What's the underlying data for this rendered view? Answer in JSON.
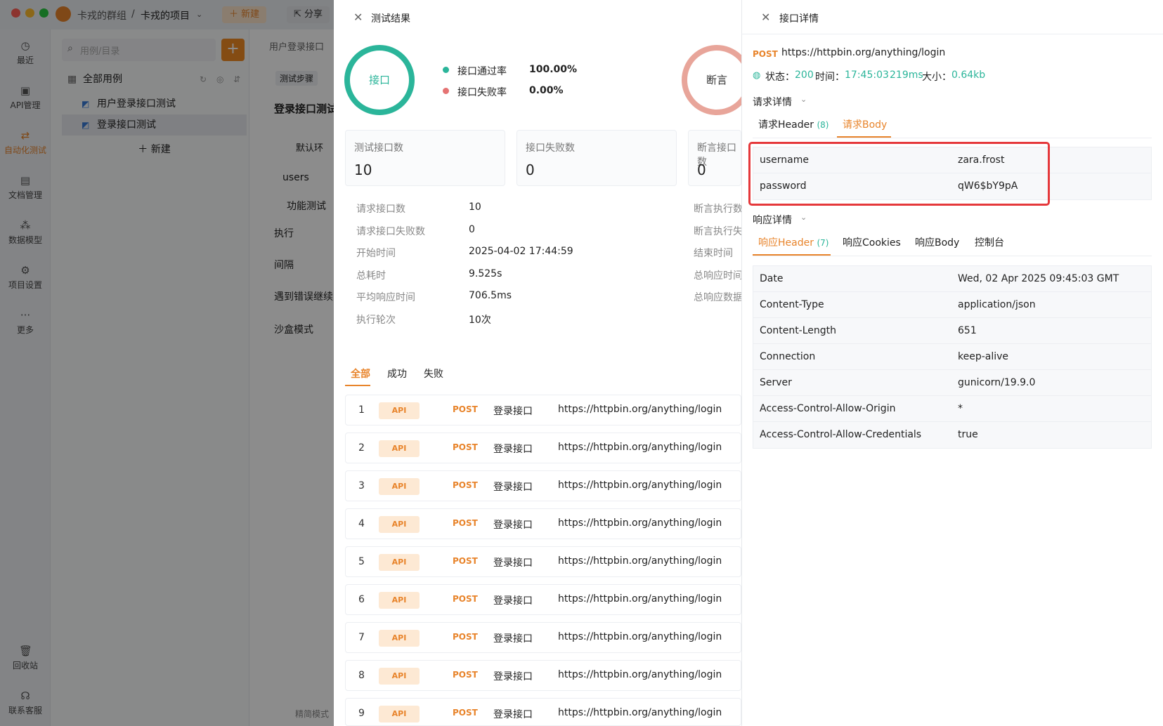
{
  "topbar": {
    "group": "卡戎的群组",
    "sep": "/",
    "project": "卡戎的项目",
    "new_label": "新建",
    "share_label": "分享"
  },
  "rail": {
    "items": [
      {
        "label": "最近",
        "icon": "clock-icon"
      },
      {
        "label": "API管理",
        "icon": "api-icon"
      },
      {
        "label": "自动化测试",
        "icon": "automation-icon"
      },
      {
        "label": "文档管理",
        "icon": "document-icon"
      },
      {
        "label": "数据模型",
        "icon": "data-model-icon"
      },
      {
        "label": "项目设置",
        "icon": "settings-icon"
      },
      {
        "label": "更多",
        "icon": "more-icon"
      },
      {
        "label": "回收站",
        "icon": "trash-icon"
      },
      {
        "label": "联系客服",
        "icon": "headset-icon"
      }
    ]
  },
  "tree": {
    "search_placeholder": "用例/目录",
    "root": "全部用例",
    "items": [
      "用户登录接口测试",
      "登录接口测试"
    ],
    "new_label": "新建"
  },
  "editor": {
    "breadcrumb": "用户登录接口",
    "tab": "测试步骤",
    "title": "登录接口测试",
    "env": "默认环",
    "users": "users",
    "mode": "功能测试",
    "exec": "执行",
    "interval": "间隔",
    "on_error": "遇到错误继续",
    "sandbox": "沙盒模式",
    "simple": "精简模式"
  },
  "result": {
    "title": "测试结果",
    "ring1_label": "接口",
    "pass_rate_label": "接口通过率",
    "pass_rate": "100.00%",
    "fail_rate_label": "接口失败率",
    "fail_rate": "0.00%",
    "ring2_label": "断言",
    "cards": [
      {
        "label": "测试接口数",
        "value": "10"
      },
      {
        "label": "接口失败数",
        "value": "0"
      },
      {
        "label": "断言接口数",
        "value": "0"
      }
    ],
    "kv": [
      {
        "label": "请求接口数",
        "value": "10"
      },
      {
        "label": "请求接口失败数",
        "value": "0"
      },
      {
        "label": "开始时间",
        "value": "2025-04-02 17:44:59"
      },
      {
        "label": "总耗时",
        "value": "9.525s"
      },
      {
        "label": "平均响应时间",
        "value": "706.5ms"
      },
      {
        "label": "执行轮次",
        "value": "10次"
      }
    ],
    "kv_right": [
      "断言执行数",
      "断言执行失",
      "结束时间",
      "总响应时间",
      "总响应数据"
    ],
    "tabs": [
      "全部",
      "成功",
      "失败"
    ],
    "rows": [
      {
        "idx": "1",
        "tag": "API",
        "method": "POST",
        "name": "登录接口",
        "url": "https://httpbin.org/anything/login"
      },
      {
        "idx": "2",
        "tag": "API",
        "method": "POST",
        "name": "登录接口",
        "url": "https://httpbin.org/anything/login"
      },
      {
        "idx": "3",
        "tag": "API",
        "method": "POST",
        "name": "登录接口",
        "url": "https://httpbin.org/anything/login"
      },
      {
        "idx": "4",
        "tag": "API",
        "method": "POST",
        "name": "登录接口",
        "url": "https://httpbin.org/anything/login"
      },
      {
        "idx": "5",
        "tag": "API",
        "method": "POST",
        "name": "登录接口",
        "url": "https://httpbin.org/anything/login"
      },
      {
        "idx": "6",
        "tag": "API",
        "method": "POST",
        "name": "登录接口",
        "url": "https://httpbin.org/anything/login"
      },
      {
        "idx": "7",
        "tag": "API",
        "method": "POST",
        "name": "登录接口",
        "url": "https://httpbin.org/anything/login"
      },
      {
        "idx": "8",
        "tag": "API",
        "method": "POST",
        "name": "登录接口",
        "url": "https://httpbin.org/anything/login"
      },
      {
        "idx": "9",
        "tag": "API",
        "method": "POST",
        "name": "登录接口",
        "url": "https://httpbin.org/anything/login"
      }
    ]
  },
  "detail": {
    "title": "接口详情",
    "method": "POST",
    "url": "https://httpbin.org/anything/login",
    "status_label": "状态：",
    "status": "200",
    "time_label": "时间：",
    "time": "17:45:03",
    "duration": "219ms",
    "size_label": "大小：",
    "size": "0.64kb",
    "request_section": "请求详情",
    "req_tabs": [
      {
        "label": "请求Header",
        "count": "(8)"
      },
      {
        "label": "请求Body",
        "count": ""
      }
    ],
    "body_rows": [
      {
        "key": "username",
        "value": "zara.frost"
      },
      {
        "key": "password",
        "value": "qW6$bY9pA"
      }
    ],
    "response_section": "响应详情",
    "resp_tabs": [
      {
        "label": "响应Header",
        "count": "(7)"
      },
      {
        "label": "响应Cookies",
        "count": ""
      },
      {
        "label": "响应Body",
        "count": ""
      },
      {
        "label": "控制台",
        "count": ""
      }
    ],
    "header_rows": [
      {
        "key": "Date",
        "value": "Wed, 02 Apr 2025 09:45:03 GMT"
      },
      {
        "key": "Content-Type",
        "value": "application/json"
      },
      {
        "key": "Content-Length",
        "value": "651"
      },
      {
        "key": "Connection",
        "value": "keep-alive"
      },
      {
        "key": "Server",
        "value": "gunicorn/19.9.0"
      },
      {
        "key": "Access-Control-Allow-Origin",
        "value": "*"
      },
      {
        "key": "Access-Control-Allow-Credentials",
        "value": "true"
      }
    ]
  },
  "colors": {
    "accent": "#e8842b",
    "success": "#2bb59a",
    "danger": "#e5383b"
  }
}
